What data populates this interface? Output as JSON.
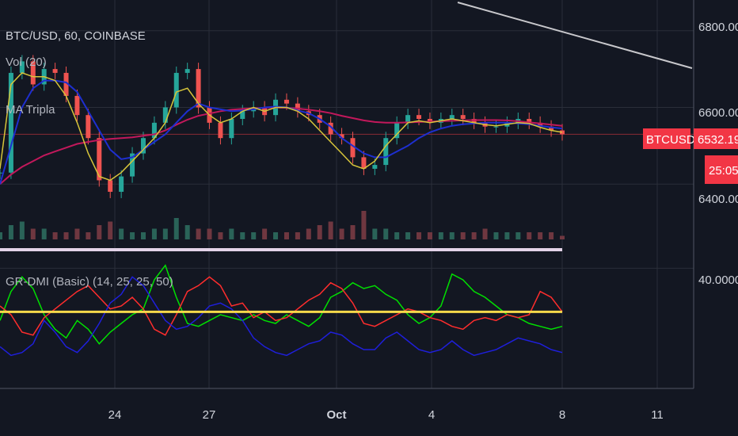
{
  "chart_data": [
    {
      "type": "candlestick",
      "panel": "price",
      "title": "BTC/USD, 60, COINBASE",
      "indicators": [
        "Vol (20)",
        "MA Tripla"
      ],
      "y_ticks": [
        "6800.00",
        "6600.00",
        "6400.00"
      ],
      "ylim": [
        6260,
        6880
      ],
      "last_price_badge": {
        "symbol": "BTCUSD",
        "price": "6532.19",
        "countdown": "25:05"
      },
      "close_series": [
        6430,
        6690,
        6720,
        6660,
        6700,
        6690,
        6630,
        6580,
        6520,
        6410,
        6380,
        6420,
        6480,
        6520,
        6560,
        6600,
        6690,
        6700,
        6600,
        6560,
        6520,
        6570,
        6590,
        6600,
        6580,
        6620,
        6610,
        6590,
        6580,
        6560,
        6530,
        6520,
        6470,
        6440,
        6450,
        6520,
        6560,
        6580,
        6570,
        6560,
        6570,
        6580,
        6570,
        6560,
        6550,
        6550,
        6560,
        6570,
        6560,
        6550,
        6540,
        6530
      ],
      "ma_fast_yellow": [
        6440,
        6660,
        6690,
        6680,
        6680,
        6670,
        6630,
        6560,
        6480,
        6420,
        6410,
        6430,
        6460,
        6490,
        6520,
        6560,
        6640,
        6650,
        6610,
        6580,
        6560,
        6570,
        6590,
        6600,
        6590,
        6600,
        6600,
        6590,
        6570,
        6540,
        6510,
        6480,
        6450,
        6440,
        6460,
        6500,
        6530,
        6560,
        6565,
        6560,
        6565,
        6570,
        6565,
        6560,
        6555,
        6552,
        6556,
        6560,
        6558,
        6548,
        6540,
        6535
      ],
      "ma_mid_blue": [
        6400,
        6500,
        6600,
        6650,
        6670,
        6670,
        6665,
        6640,
        6590,
        6540,
        6490,
        6465,
        6470,
        6490,
        6510,
        6530,
        6560,
        6590,
        6610,
        6600,
        6595,
        6590,
        6592,
        6595,
        6600,
        6602,
        6600,
        6592,
        6585,
        6570,
        6550,
        6520,
        6500,
        6480,
        6470,
        6470,
        6485,
        6500,
        6520,
        6535,
        6545,
        6552,
        6556,
        6558,
        6560,
        6560,
        6560,
        6558,
        6556,
        6552,
        6548,
        6545
      ],
      "ma_slow_red": [
        6400,
        6425,
        6445,
        6460,
        6475,
        6485,
        6495,
        6505,
        6510,
        6515,
        6518,
        6520,
        6522,
        6526,
        6530,
        6540,
        6555,
        6568,
        6578,
        6584,
        6590,
        6594,
        6596,
        6598,
        6599,
        6600,
        6599,
        6597,
        6594,
        6590,
        6585,
        6578,
        6572,
        6566,
        6562,
        6560,
        6560,
        6561,
        6562,
        6563,
        6564,
        6565,
        6566,
        6567,
        6567,
        6567,
        6566,
        6564,
        6561,
        6558,
        6555,
        6552
      ],
      "volume_series": [
        0.2,
        0.4,
        0.5,
        0.3,
        0.3,
        0.2,
        0.2,
        0.3,
        0.2,
        0.4,
        0.5,
        0.3,
        0.2,
        0.2,
        0.3,
        0.3,
        0.6,
        0.4,
        0.3,
        0.3,
        0.2,
        0.3,
        0.2,
        0.2,
        0.3,
        0.2,
        0.2,
        0.2,
        0.3,
        0.4,
        0.5,
        0.3,
        0.4,
        0.8,
        0.3,
        0.3,
        0.2,
        0.2,
        0.2,
        0.2,
        0.2,
        0.2,
        0.2,
        0.2,
        0.3,
        0.2,
        0.2,
        0.2,
        0.2,
        0.2,
        0.2,
        0.1
      ]
    },
    {
      "type": "line",
      "panel": "indicator",
      "title": "GR-DMI (Basic) (14, 25, 25, 50)",
      "y_ticks": [
        "40.0000"
      ],
      "ylim": [
        0,
        45
      ],
      "threshold": 25,
      "series": [
        {
          "color": "#00e000",
          "values": [
            22,
            32,
            37,
            33,
            24,
            19,
            16,
            22,
            19,
            14,
            18,
            21,
            24,
            26,
            36,
            41,
            30,
            21,
            20,
            22,
            24,
            23,
            22,
            24,
            22,
            21,
            24,
            22,
            20,
            23,
            30,
            32,
            35,
            33,
            34,
            31,
            29,
            24,
            21,
            23,
            27,
            38,
            36,
            32,
            30,
            27,
            24,
            23,
            21,
            20,
            19,
            20
          ]
        },
        {
          "color": "#ff2d2d",
          "values": [
            27,
            24,
            18,
            17,
            23,
            26,
            29,
            32,
            34,
            30,
            26,
            27,
            30,
            26,
            19,
            17,
            24,
            32,
            34,
            37,
            34,
            27,
            28,
            23,
            25,
            22,
            23,
            26,
            29,
            31,
            35,
            33,
            28,
            21,
            20,
            22,
            24,
            26,
            25,
            23,
            22,
            20,
            19,
            22,
            23,
            22,
            24,
            23,
            24,
            32,
            30,
            25
          ]
        },
        {
          "color": "#1f1fdb",
          "values": [
            13,
            10,
            11,
            14,
            22,
            18,
            13,
            11,
            15,
            21,
            28,
            31,
            37,
            34,
            28,
            22,
            19,
            20,
            23,
            27,
            28,
            26,
            22,
            16,
            13,
            11,
            10,
            12,
            14,
            15,
            18,
            17,
            14,
            12,
            12,
            16,
            18,
            15,
            12,
            11,
            12,
            15,
            12,
            10,
            11,
            12,
            14,
            16,
            15,
            14,
            12,
            11
          ]
        }
      ]
    }
  ],
  "x_labels": [
    "24",
    "27",
    "Oct",
    "4",
    "8",
    "11"
  ]
}
